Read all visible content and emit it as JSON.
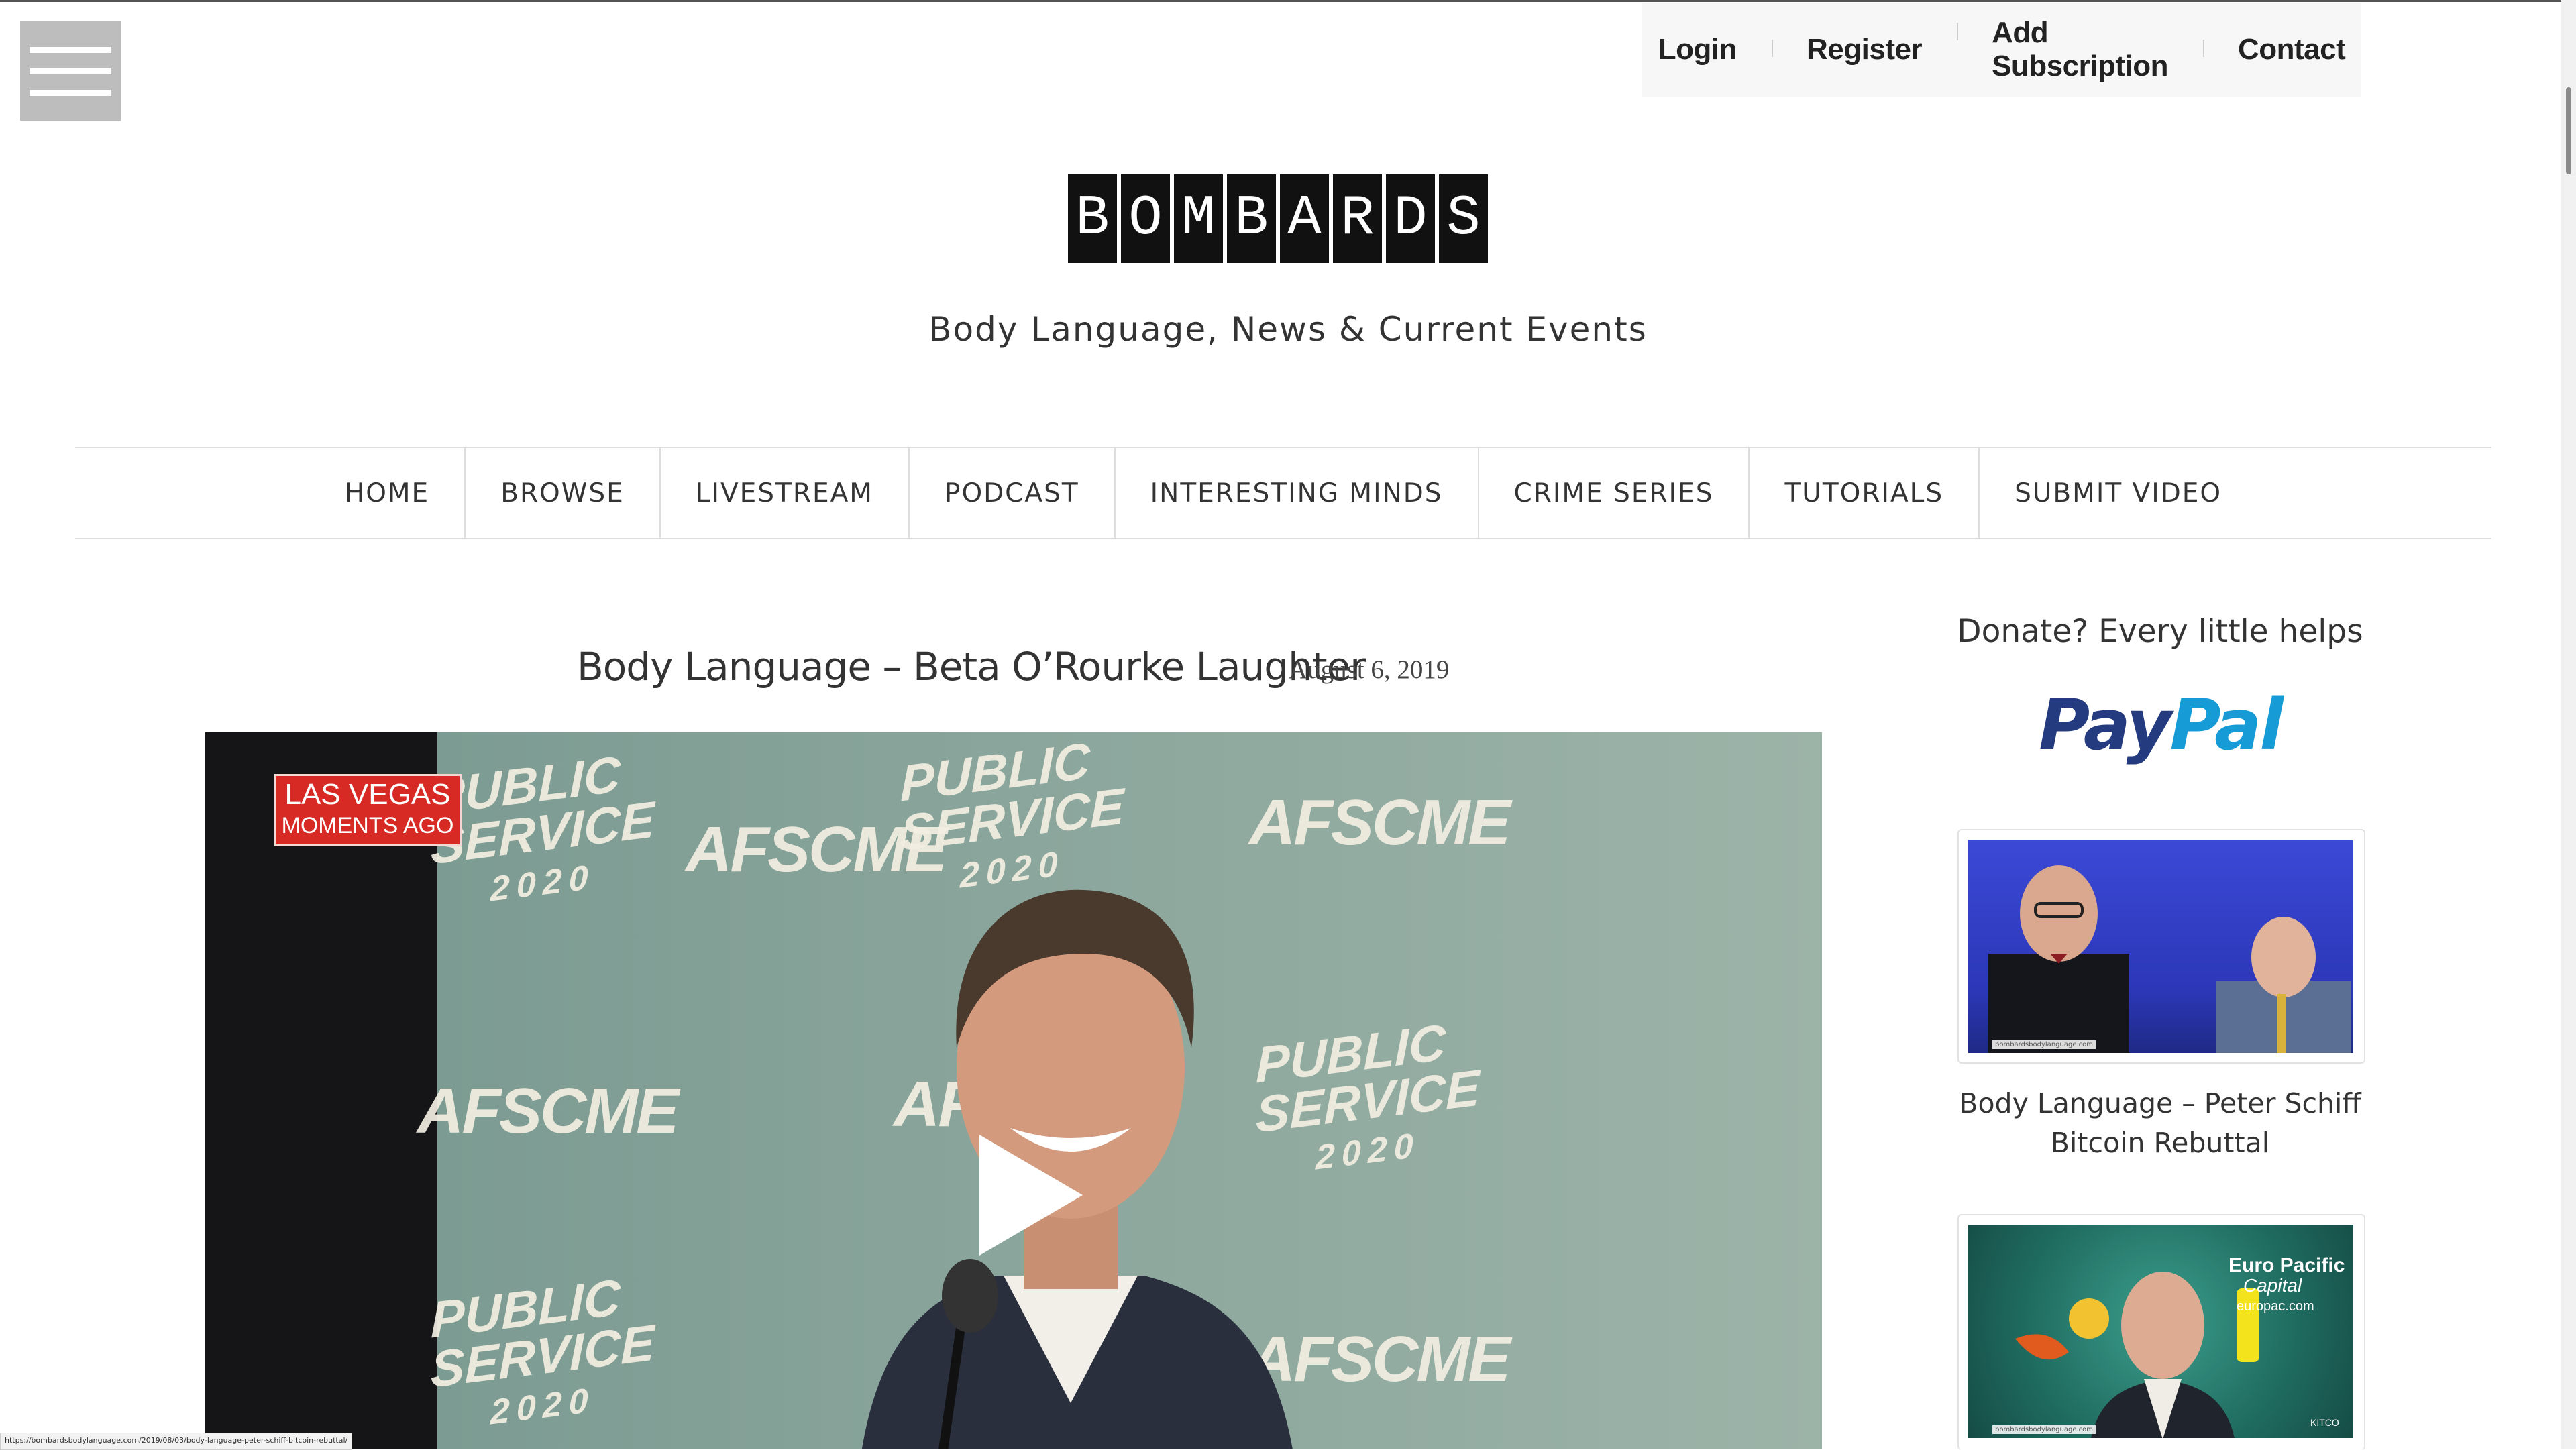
{
  "top_links": [
    {
      "label": "Login"
    },
    {
      "label": "Register"
    },
    {
      "label": "Add Subscription"
    },
    {
      "label": "Contact"
    }
  ],
  "site": {
    "logo_letters": [
      "B",
      "O",
      "M",
      "B",
      "A",
      "R",
      "D",
      "S"
    ],
    "tagline": "Body Language, News & Current Events"
  },
  "nav": [
    "HOME",
    "BROWSE",
    "LIVESTREAM",
    "PODCAST",
    "INTERESTING MINDS",
    "CRIME SERIES",
    "TUTORIALS",
    "SUBMIT VIDEO"
  ],
  "post": {
    "title": "Body Language – Beta O’Rourke Laughter",
    "date": "August 6, 2019",
    "video": {
      "badge_line1": "LAS VEGAS",
      "badge_line2": "MOMENTS AGO",
      "backdrop_brand": "AFSCME",
      "backdrop_line1": "PUBLIC",
      "backdrop_line2": "SERVICE",
      "backdrop_year": "2020"
    }
  },
  "sidebar": {
    "donate_title": "Donate? Every little helps",
    "paypal_part1": "Pay",
    "paypal_part2": "Pal",
    "cards": [
      {
        "caption": "Body Language – Peter Schiff Bitcoin Rebuttal",
        "watermark": "bombardsbodylanguage.com"
      },
      {
        "overlay_line1": "Euro Pacific",
        "overlay_line2": "Capital",
        "overlay_line3": "europac.com",
        "watermark": "bombardsbodylanguage.com",
        "corner_label": "KITCO"
      }
    ]
  },
  "status_url": "https://bombardsbodylanguage.com/2019/08/03/body-language-peter-schiff-bitcoin-rebuttal/",
  "colors": {
    "paypal_dark": "#253b80",
    "paypal_light": "#179bd7",
    "badge_red": "#d72a24"
  }
}
